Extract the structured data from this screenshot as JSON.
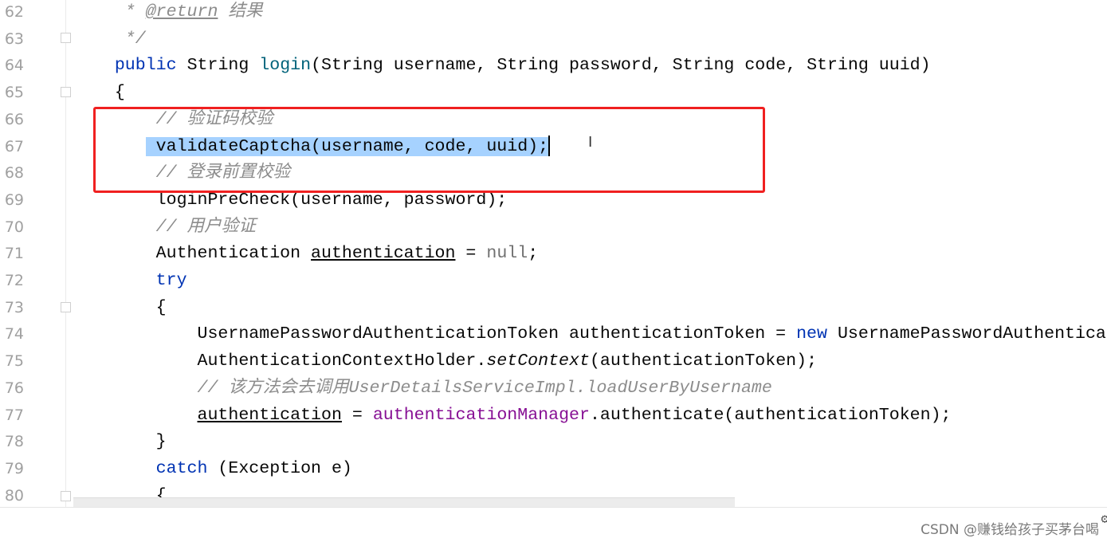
{
  "editor": {
    "lines": [
      {
        "num": "62",
        "tokens": [
          [
            "     * ",
            "cm"
          ],
          [
            "@return",
            "cm ul"
          ],
          [
            " 结果",
            "cm"
          ]
        ]
      },
      {
        "num": "63",
        "tokens": [
          [
            "     */",
            "cm"
          ]
        ]
      },
      {
        "num": "64",
        "tokens": [
          [
            "    ",
            ""
          ],
          [
            "public",
            "kw"
          ],
          [
            " String ",
            ""
          ],
          [
            "login",
            "md"
          ],
          [
            "(String username, String password, String code, String uuid)",
            ""
          ]
        ]
      },
      {
        "num": "65",
        "tokens": [
          [
            "    {",
            ""
          ]
        ]
      },
      {
        "num": "66",
        "tokens": [
          [
            "        // 验证码校验",
            "cm"
          ]
        ]
      },
      {
        "num": "67",
        "tokens": [
          [
            "       ",
            ""
          ],
          [
            " validateCaptcha(username, code, uuid);",
            "sel"
          ]
        ]
      },
      {
        "num": "68",
        "tokens": [
          [
            "        // 登录前置校验",
            "cm"
          ]
        ]
      },
      {
        "num": "69",
        "tokens": [
          [
            "        loginPreCheck(username, password);",
            ""
          ]
        ]
      },
      {
        "num": "70",
        "tokens": [
          [
            "        // 用户验证",
            "cm"
          ]
        ]
      },
      {
        "num": "71",
        "tokens": [
          [
            "        Authentication ",
            ""
          ],
          [
            "authentication",
            "ul"
          ],
          [
            " = ",
            ""
          ],
          [
            "null",
            "nl"
          ],
          [
            ";",
            ""
          ]
        ]
      },
      {
        "num": "72",
        "tokens": [
          [
            "        ",
            ""
          ],
          [
            "try",
            "kw"
          ]
        ]
      },
      {
        "num": "73",
        "tokens": [
          [
            "        {",
            ""
          ]
        ]
      },
      {
        "num": "74",
        "tokens": [
          [
            "            UsernamePasswordAuthenticationToken authenticationToken = ",
            ""
          ],
          [
            "new",
            "kw"
          ],
          [
            " UsernamePasswordAuthentica",
            ""
          ]
        ]
      },
      {
        "num": "75",
        "tokens": [
          [
            "            AuthenticationContextHolder.",
            ""
          ],
          [
            "setContext",
            "it"
          ],
          [
            "(authenticationToken);",
            ""
          ]
        ]
      },
      {
        "num": "76",
        "tokens": [
          [
            "            // 该方法会去调用UserDetailsServiceImpl.loadUserByUsername",
            "cm"
          ]
        ]
      },
      {
        "num": "77",
        "tokens": [
          [
            "            ",
            ""
          ],
          [
            "authentication",
            "ul"
          ],
          [
            " = ",
            ""
          ],
          [
            "authenticationManager",
            "fd"
          ],
          [
            ".authenticate(authenticationToken);",
            ""
          ]
        ]
      },
      {
        "num": "78",
        "tokens": [
          [
            "        }",
            ""
          ]
        ]
      },
      {
        "num": "79",
        "tokens": [
          [
            "        ",
            ""
          ],
          [
            "catch",
            "kw"
          ],
          [
            " (Exception e)",
            ""
          ]
        ]
      },
      {
        "num": "80",
        "tokens": [
          [
            "        {",
            ""
          ]
        ]
      }
    ],
    "selected_line": "67",
    "highlight_color": "#f02020",
    "selection_color": "#a6d2ff"
  },
  "footer": {
    "watermark": "CSDN @赚钱给孩子买茅台喝",
    "gear_icon": "gear-icon"
  }
}
